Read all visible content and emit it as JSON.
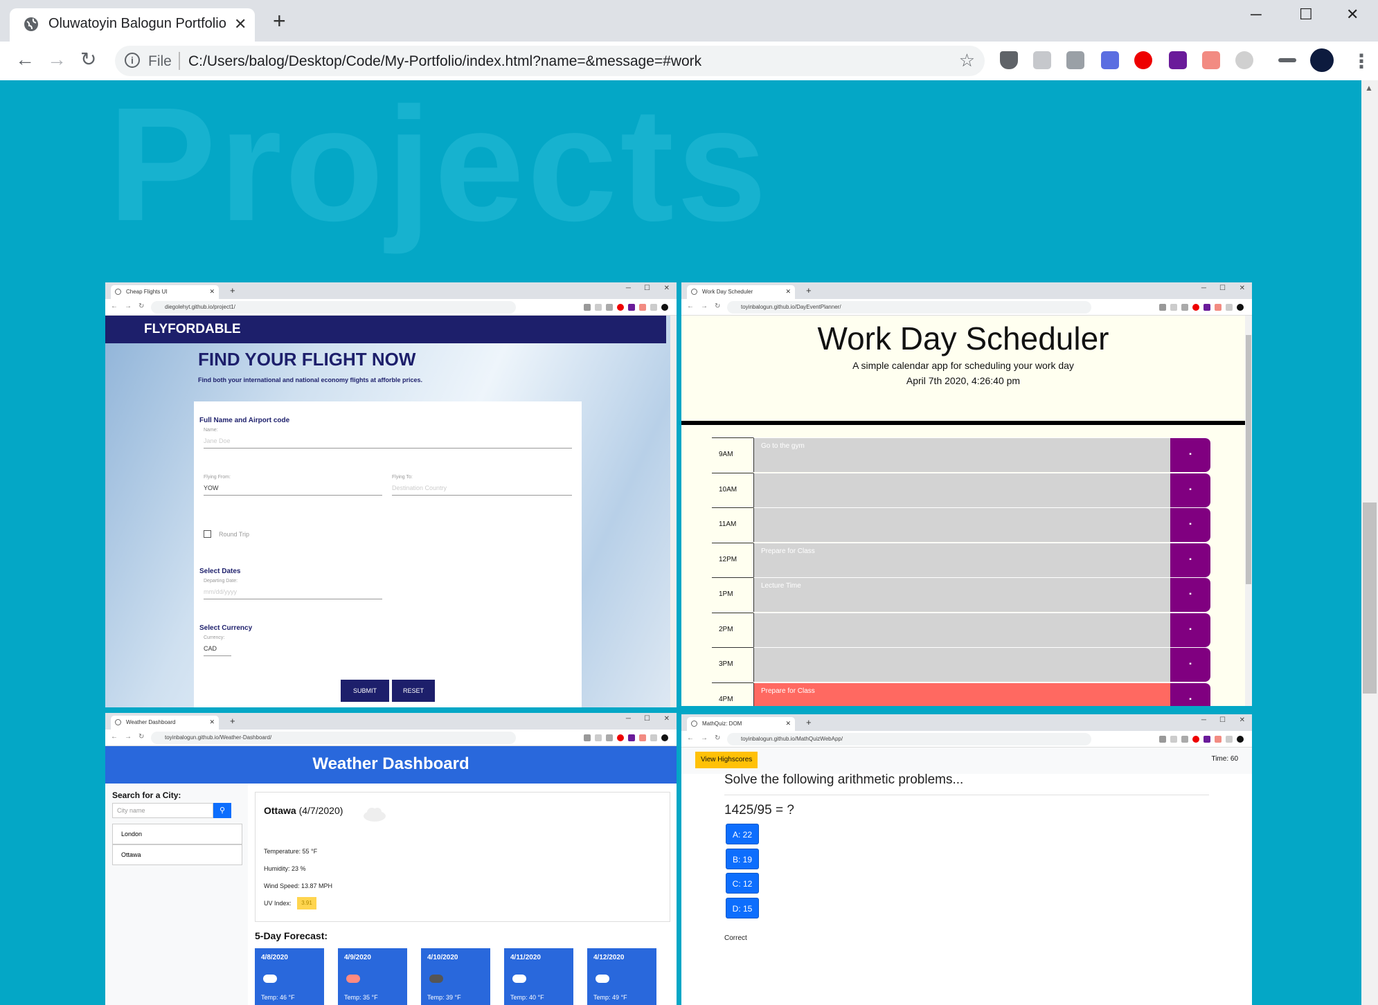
{
  "browser": {
    "tab_title": "Oluwatoyin Balogun Portfolio",
    "tab_close": "✕",
    "new_tab": "+",
    "window_controls": {
      "minimize": "─",
      "maximize": "☐",
      "close": "✕"
    },
    "nav": {
      "back": "←",
      "forward": "→",
      "reload": "↻"
    },
    "address": {
      "info": "i",
      "scheme": "File",
      "url": "C:/Users/balog/Desktop/Code/My-Portfolio/index.html?name=&message=#work",
      "bookmark": "☆"
    },
    "extensions": [
      "shield-icon",
      "r-icon",
      "k-icon",
      "s-badge-icon",
      "stop-icon",
      "p-badge-icon",
      "arrow-icon",
      "circle-icon",
      "playlist-icon",
      "profile-avatar"
    ],
    "menu": "⋮"
  },
  "page": {
    "section_title": "Projects"
  },
  "projects": [
    {
      "tab_title": "Cheap Flights UI",
      "url": "diegolehyt.github.io/project1/",
      "brand": "FLYFORDABLE",
      "headline": "FIND YOUR FLIGHT NOW",
      "subheadline": "Find both your international and national economy flights at afforble prices.",
      "form": {
        "section1": "Full Name and Airport code",
        "name_label": "Name:",
        "name_placeholder": "Jane Doe",
        "from_label": "Flying From:",
        "from_value": "YOW",
        "to_label": "Flying To:",
        "to_placeholder": "Destination Country",
        "round_trip": "Round Trip",
        "section2": "Select Dates",
        "depart_label": "Departing Date:",
        "depart_placeholder": "mm/dd/yyyy",
        "section3": "Select Currency",
        "currency_label": "Currency:",
        "currency_value": "CAD",
        "submit": "SUBMIT",
        "reset": "RESET"
      }
    },
    {
      "tab_title": "Work Day Scheduler",
      "url": "toyinbalogun.github.io/DayEventPlanner/",
      "title": "Work Day Scheduler",
      "subtitle": "A simple calendar app for scheduling your work day",
      "date": "April 7th 2020, 4:26:40 pm",
      "rows": [
        {
          "hour": "9AM",
          "text": "Go to the gym",
          "state": "past"
        },
        {
          "hour": "10AM",
          "text": "",
          "state": "past"
        },
        {
          "hour": "11AM",
          "text": "",
          "state": "past"
        },
        {
          "hour": "12PM",
          "text": "Prepare for Class",
          "state": "past"
        },
        {
          "hour": "1PM",
          "text": "Lecture Time",
          "state": "past"
        },
        {
          "hour": "2PM",
          "text": "",
          "state": "past"
        },
        {
          "hour": "3PM",
          "text": "",
          "state": "past"
        },
        {
          "hour": "4PM",
          "text": "Prepare for Class",
          "state": "present"
        }
      ],
      "colors": {
        "past": "#d3d3d3",
        "present": "#ff6961",
        "save": "#800080"
      }
    },
    {
      "tab_title": "Weather Dashboard",
      "url": "toyinbalogun.github.io/Weather-Dashboard/",
      "title": "Weather Dashboard",
      "search_label": "Search for a City:",
      "search_placeholder": "City name",
      "history": [
        "London",
        "Ottawa"
      ],
      "city": "Ottawa",
      "date": "(4/7/2020)",
      "temperature": "Temperature: 55 °F",
      "humidity": "Humidity: 23 %",
      "wind": "Wind Speed: 13.87 MPH",
      "uv_label": "UV Index:",
      "uv_value": "3.91",
      "forecast_title": "5-Day Forecast:",
      "forecast": [
        {
          "date": "4/8/2020",
          "icon": "cloud-icon",
          "temp": "Temp: 46 °F"
        },
        {
          "date": "4/9/2020",
          "icon": "rain-icon",
          "temp": "Temp: 35 °F"
        },
        {
          "date": "4/10/2020",
          "icon": "storm-icon",
          "temp": "Temp: 39 °F"
        },
        {
          "date": "4/11/2020",
          "icon": "cloud-icon",
          "temp": "Temp: 40 °F"
        },
        {
          "date": "4/12/2020",
          "icon": "cloud-icon",
          "temp": "Temp: 49 °F"
        }
      ]
    },
    {
      "tab_title": "MathQuiz: DOM",
      "url": "toyinbalogun.github.io/MathQuizWebApp/",
      "highscores": "View Highscores",
      "timer": "Time: 60",
      "heading": "Solve the following arithmetic problems...",
      "question": "1425/95 = ?",
      "answers": [
        "A: 22",
        "B: 19",
        "C: 12",
        "D: 15"
      ],
      "feedback": "Correct"
    }
  ]
}
